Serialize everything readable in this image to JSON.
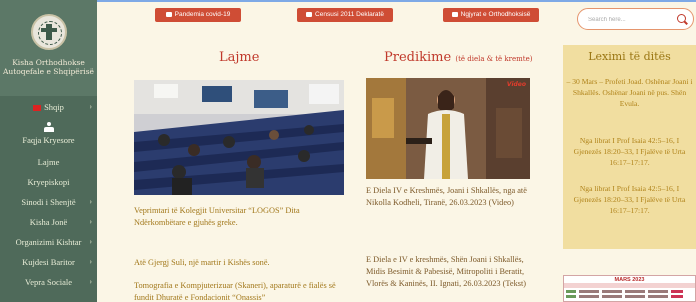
{
  "sidebar": {
    "logo_name_line1": "Kisha Orthodhokse",
    "logo_name_line2": "Autoqefale e Shqipërisë",
    "lang_label": "Shqip",
    "home_label": "Faqja Kryesore",
    "items": [
      {
        "label": "Lajme",
        "chevron": false
      },
      {
        "label": "Kryepiskopi",
        "chevron": false
      },
      {
        "label": "Sinodi i Shenjtë",
        "chevron": true
      },
      {
        "label": "Kisha Jonë",
        "chevron": true
      },
      {
        "label": "Organizimi Kishtar",
        "chevron": true
      },
      {
        "label": "Kujdesi Baritor",
        "chevron": true
      },
      {
        "label": "Vepra Sociale",
        "chevron": true
      }
    ]
  },
  "topbar": {
    "btn1": "Pandemia covid-19",
    "btn2": "Censusi 2011 Deklaratë",
    "btn3": "Ngjyrat e Orthodhoksisë",
    "search_placeholder": "Search here..."
  },
  "lajme": {
    "title": "Lajme",
    "articles": [
      "Veprimtari të Kolegjit Universitar “LOGOS” Dita Ndërkombëtare e gjuhës greke.",
      "Atë Gjergj Suli, një martir i Kishës sonë.",
      "Tomografia e Kompjuterizuar (Skaneri), aparaturë e fialës së fundit Dhuratë e Fondacionit “Onassis”"
    ]
  },
  "predikime": {
    "title": "Predikime",
    "subtitle": "(të diela & të kremte)",
    "image_badge": "Video",
    "articles": [
      "E Diela IV e Kreshmës, Joani i Shkallës, nga atë Nikolla Kodheli, Tiranë, 26.03.2023 (Video)",
      "E Diela e IV e kreshmës, Shën Joani i Shkallës, Midis Besimit & Pabesisë, Mitropoliti i Beratit, Vlorës & Kaninës, II. Ignati, 26.03.2023 (Tekst)"
    ]
  },
  "leximi": {
    "title": "Leximi të ditës",
    "text1": "– 30 Mars – Profeti Joad. Oshënar Joani i Shkallës. Oshënar Joani në pus. Shën Evula.",
    "text2": "Nga librat I Prof Isaia 42:5–16, I Gjenezës 18:20–33, I Fjalëve të Urta 16:17–17:17.",
    "text3": "Nga librat I Prof Isaia 42:5–16, I Gjenezës 18:20–33, I Fjalëve të Urta 16:17–17:17."
  },
  "calendar": {
    "title": "MARS 2023"
  }
}
